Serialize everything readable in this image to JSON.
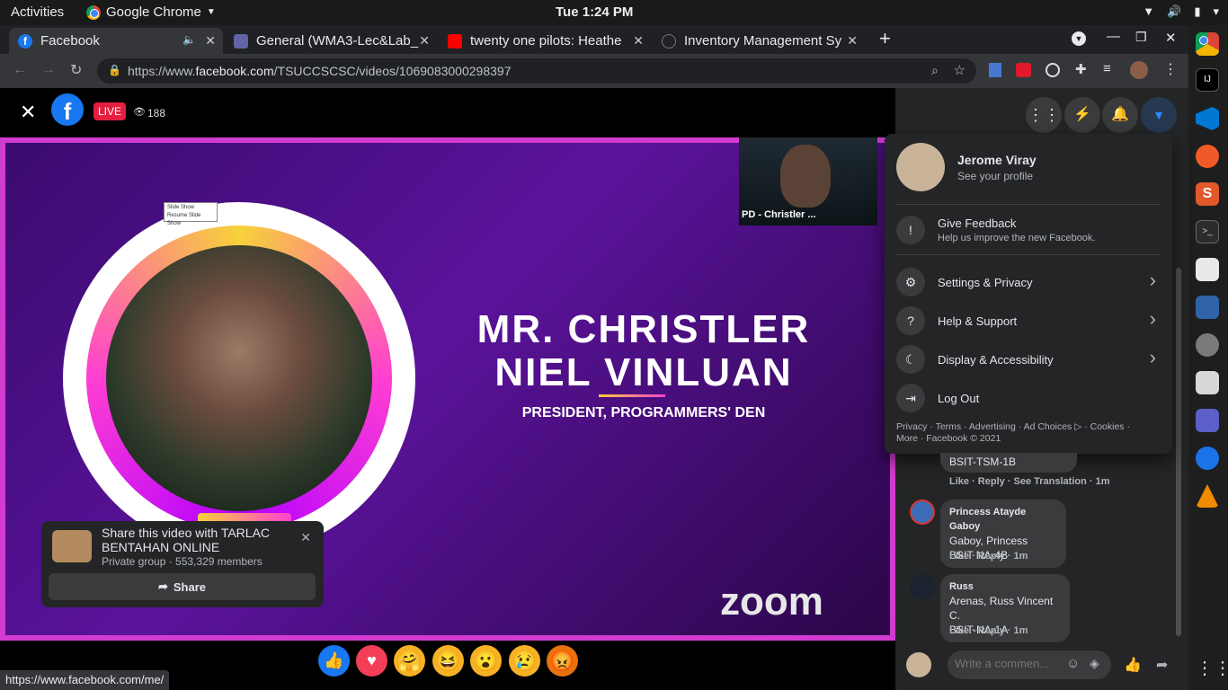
{
  "os": {
    "activities": "Activities",
    "app_name": "Google Chrome",
    "clock": "Tue  1:24 PM"
  },
  "tabs": [
    {
      "title": "Facebook"
    },
    {
      "title": "General (WMA3-Lec&Lab_"
    },
    {
      "title": "twenty one pilots: Heathe"
    },
    {
      "title": "Inventory Management Sy"
    }
  ],
  "address": {
    "prefix": "https://www.",
    "host": "facebook.com",
    "path": "/TSUCCSCSC/videos/1069083000298397"
  },
  "video": {
    "live_label": "LIVE",
    "viewers": "188",
    "pip_label": "PD - Christler ...",
    "zoom_logo": "zoom"
  },
  "slide": {
    "name_line1": "MR. CHRISTLER",
    "name_line2": "NIEL VINLUAN",
    "role": "PRESIDENT, PROGRAMMERS' DEN",
    "popup_line1": "Slide Show",
    "popup_line2": "Resume Slide Show"
  },
  "share_card": {
    "title": "Share this video with TARLAC BENTAHAN ONLINE",
    "sub": "Private group · 553,329 members",
    "button": "Share"
  },
  "menu": {
    "profile_name": "Jerome Viray",
    "profile_sub": "See your profile",
    "feedback_title": "Give Feedback",
    "feedback_sub": "Help us improve the new Facebook.",
    "settings": "Settings & Privacy",
    "help": "Help & Support",
    "display": "Display & Accessibility",
    "logout": "Log Out",
    "footer_line1": "Privacy · Terms · Advertising · Ad Choices ▷ · Cookies ·",
    "footer_line2": "More · Facebook © 2021"
  },
  "comments": [
    {
      "author": "",
      "text1": "BSIT-TSM-1B",
      "text2": "",
      "meta": "Like · Reply · See Translation · 1m"
    },
    {
      "author": "Princess Atayde Gaboy",
      "text1": "Gaboy, Princess",
      "text2": "BSIT NA-4B",
      "meta": "Like · Reply · 1m"
    },
    {
      "author": "Russ",
      "text1": "Arenas, Russ Vincent C.",
      "text2": "BSIT-NA-1A",
      "meta": "Like · Reply · 1m"
    }
  ],
  "comment_input": {
    "placeholder": "Write a commen..."
  },
  "status_url": "https://www.facebook.com/me/",
  "colors": {
    "facebook_blue": "#1877f2",
    "live_red": "#e41e3f",
    "panel_bg": "#242526",
    "slide_purple": "#5b139c"
  }
}
